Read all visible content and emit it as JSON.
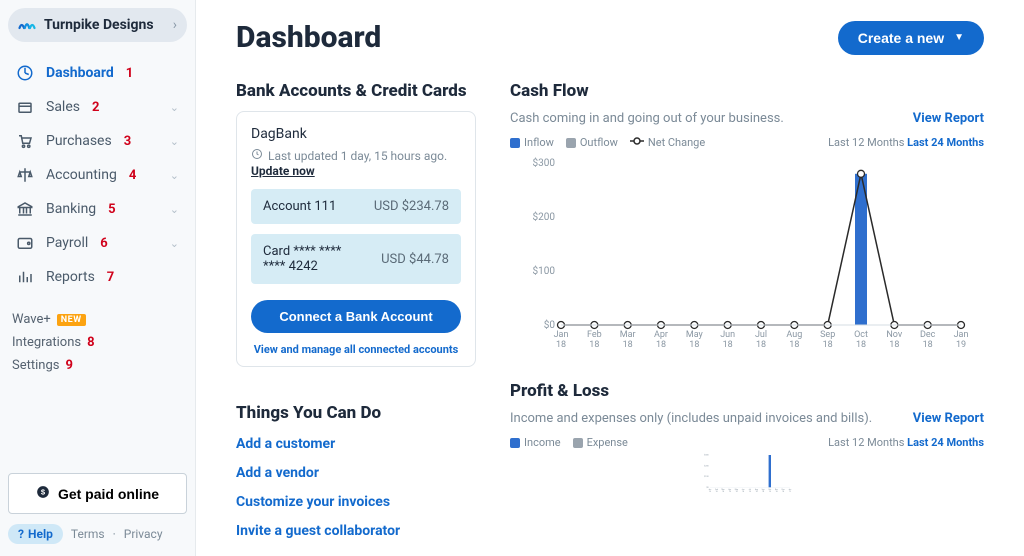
{
  "org": {
    "name": "Turnpike Designs"
  },
  "sidebar": {
    "items": [
      {
        "label": "Dashboard",
        "anno": "1",
        "expandable": false
      },
      {
        "label": "Sales",
        "anno": "2",
        "expandable": true
      },
      {
        "label": "Purchases",
        "anno": "3",
        "expandable": true
      },
      {
        "label": "Accounting",
        "anno": "4",
        "expandable": true
      },
      {
        "label": "Banking",
        "anno": "5",
        "expandable": true
      },
      {
        "label": "Payroll",
        "anno": "6",
        "expandable": true
      },
      {
        "label": "Reports",
        "anno": "7",
        "expandable": false
      }
    ],
    "secondary": [
      {
        "label": "Wave+",
        "badge": "NEW"
      },
      {
        "label": "Integrations",
        "anno": "8"
      },
      {
        "label": "Settings",
        "anno": "9"
      }
    ]
  },
  "sidebar_footer": {
    "paid": "Get paid online",
    "help": "Help",
    "terms": "Terms",
    "privacy": "Privacy"
  },
  "header": {
    "title": "Dashboard",
    "create": "Create a new"
  },
  "bank": {
    "title": "Bank Accounts & Credit Cards",
    "provider": "DagBank",
    "updated": "Last updated 1 day, 15 hours ago.",
    "update_now": "Update now",
    "accounts": [
      {
        "name": "Account 111",
        "balance": "USD $234.78"
      },
      {
        "name": "Card **** **** **** 4242",
        "balance": "USD $44.78"
      }
    ],
    "connect": "Connect a Bank Account",
    "manage": "View and manage all connected accounts"
  },
  "things": {
    "title": "Things You Can Do",
    "links": [
      "Add a customer",
      "Add a vendor",
      "Customize your invoices",
      "Invite a guest collaborator"
    ]
  },
  "cashflow": {
    "title": "Cash Flow",
    "sub": "Cash coming in and going out of your business.",
    "view_report": "View Report",
    "legend": {
      "inflow": "Inflow",
      "outflow": "Outflow",
      "net": "Net Change"
    },
    "timeframe": {
      "last12": "Last 12 Months",
      "last24": "Last 24 Months"
    }
  },
  "profitloss": {
    "title": "Profit & Loss",
    "sub": "Income and expenses only (includes unpaid invoices and bills).",
    "view_report": "View Report",
    "legend": {
      "income": "Income",
      "expense": "Expense"
    }
  },
  "chart_data": [
    {
      "type": "bar+line",
      "title": "Cash Flow",
      "ylabel": "",
      "ylim": [
        0,
        300
      ],
      "x": [
        "Jan 18",
        "Feb 18",
        "Mar 18",
        "Apr 18",
        "May 18",
        "Jun 18",
        "Jul 18",
        "Aug 18",
        "Sep 18",
        "Oct 18",
        "Nov 18",
        "Dec 18",
        "Jan 19"
      ],
      "series": [
        {
          "name": "Inflow",
          "type": "bar",
          "color": "#2f6fce",
          "values": [
            0,
            0,
            0,
            0,
            0,
            0,
            0,
            0,
            0,
            280,
            0,
            0,
            0
          ]
        },
        {
          "name": "Outflow",
          "type": "bar",
          "color": "#9aa4ae",
          "values": [
            0,
            0,
            0,
            0,
            0,
            0,
            0,
            0,
            0,
            0,
            0,
            0,
            0
          ]
        },
        {
          "name": "Net Change",
          "type": "line",
          "color": "#2a2a2a",
          "values": [
            0,
            0,
            0,
            0,
            0,
            0,
            0,
            0,
            0,
            280,
            0,
            0,
            0
          ]
        }
      ]
    },
    {
      "type": "bar",
      "title": "Profit & Loss",
      "ylim": [
        0,
        300
      ],
      "x": [
        "Jan 18",
        "Feb 18",
        "Mar 18",
        "Apr 18",
        "May 18",
        "Jun 18",
        "Jul 18",
        "Aug 18",
        "Sep 18",
        "Oct 18",
        "Nov 18",
        "Dec 18",
        "Jan 19"
      ],
      "series": [
        {
          "name": "Income",
          "type": "bar",
          "color": "#2f6fce",
          "values": [
            0,
            0,
            0,
            0,
            0,
            0,
            0,
            0,
            0,
            300,
            0,
            0,
            0
          ]
        },
        {
          "name": "Expense",
          "type": "bar",
          "color": "#9aa4ae",
          "values": [
            0,
            0,
            0,
            0,
            0,
            0,
            0,
            0,
            0,
            0,
            0,
            0,
            0
          ]
        }
      ]
    }
  ]
}
